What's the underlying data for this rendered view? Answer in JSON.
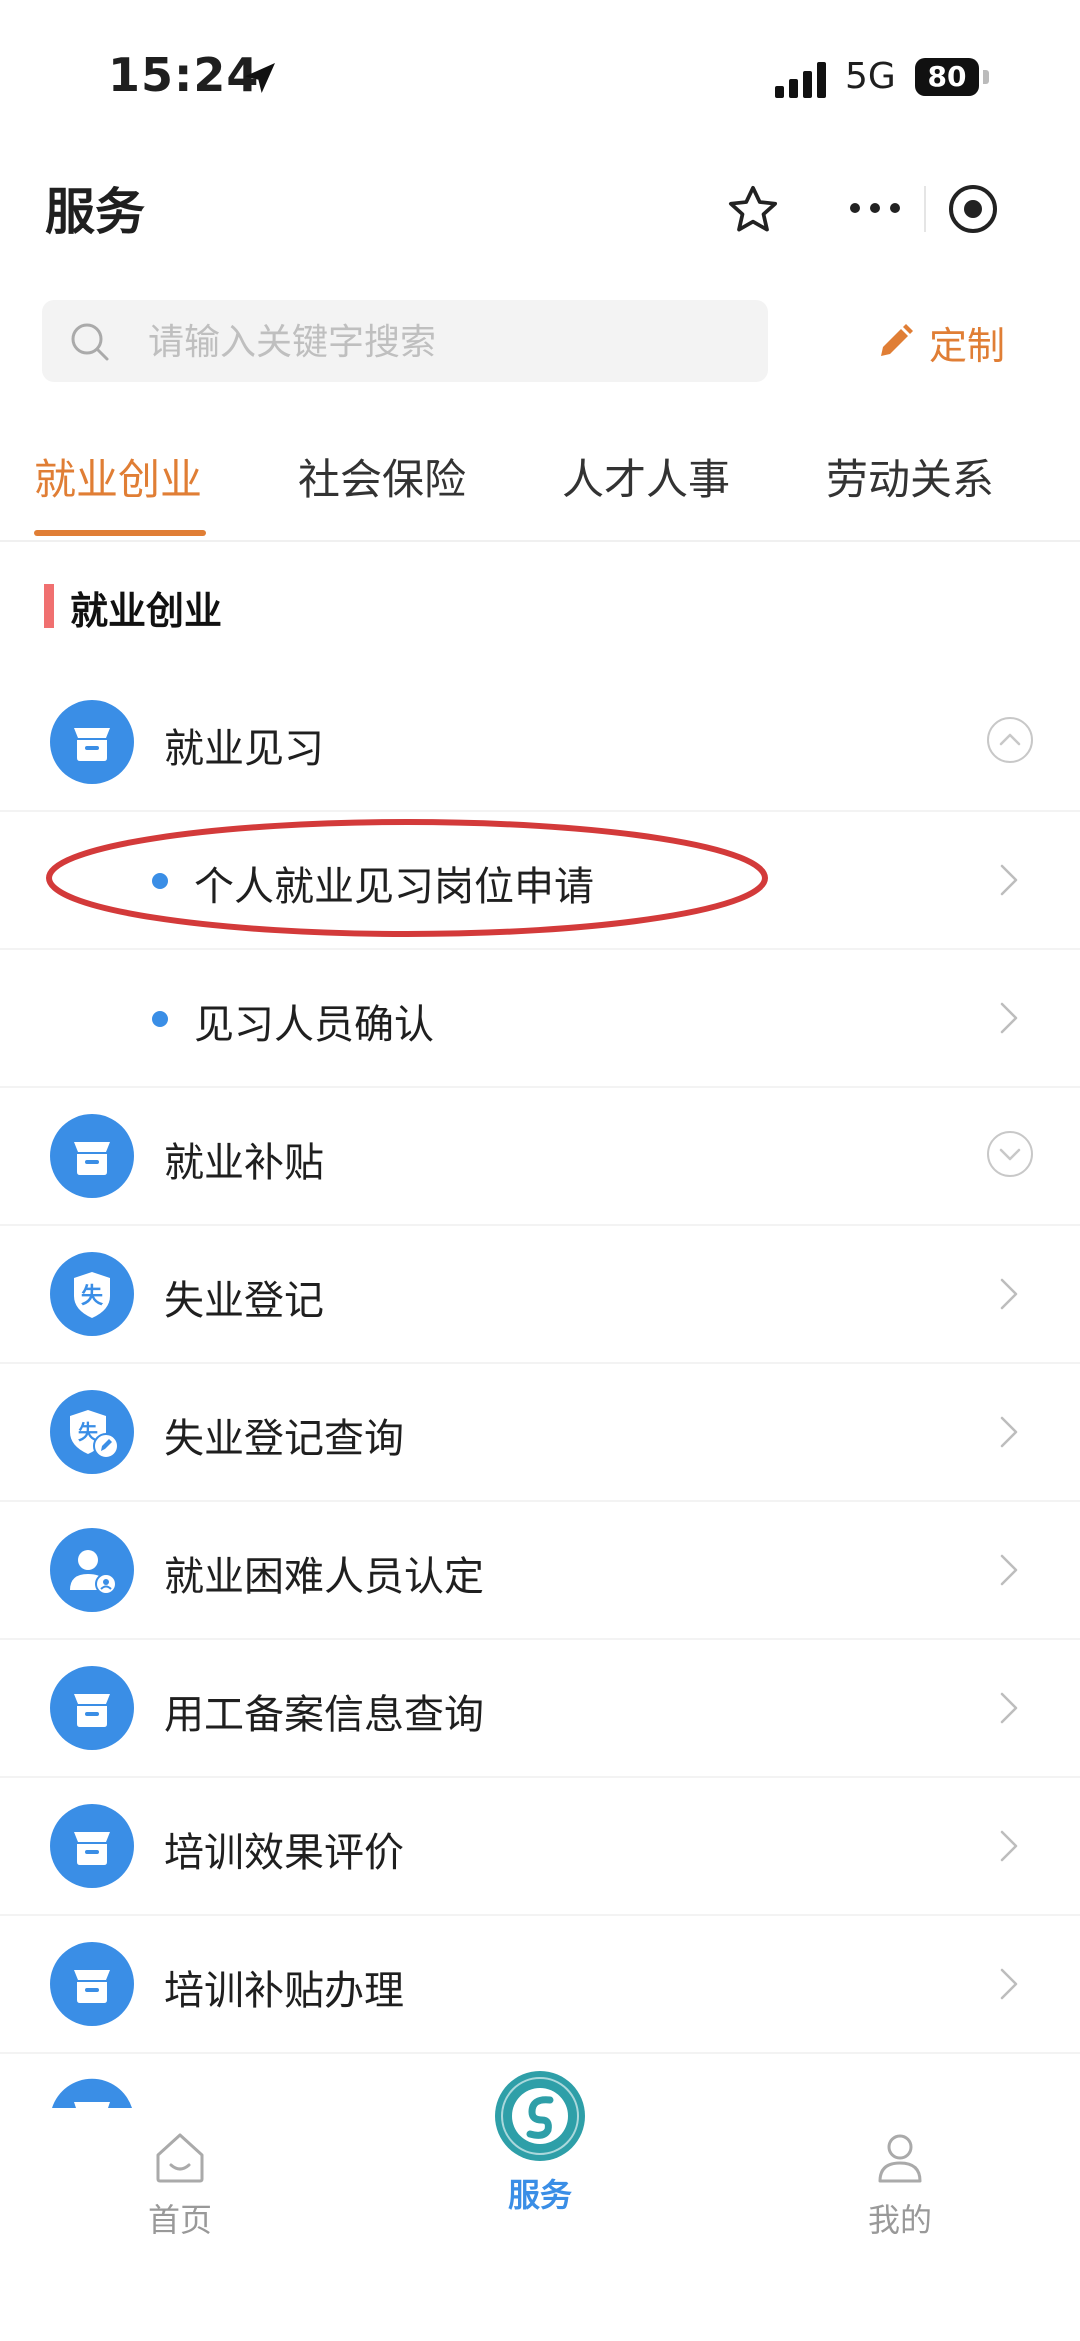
{
  "status_bar": {
    "time": "15:24",
    "network": "5G",
    "battery": "80"
  },
  "header": {
    "title": "服务"
  },
  "search": {
    "placeholder": "请输入关键字搜索",
    "customize_label": "定制"
  },
  "tabs": [
    {
      "label": "就业创业",
      "active": true
    },
    {
      "label": "社会保险",
      "active": false
    },
    {
      "label": "人才人事",
      "active": false
    },
    {
      "label": "劳动关系",
      "active": false
    }
  ],
  "section": {
    "title": "就业创业"
  },
  "items": [
    {
      "label": "就业见习",
      "icon": "box-icon",
      "expanded": true,
      "children": [
        {
          "label": "个人就业见习岗位申请",
          "highlighted": true
        },
        {
          "label": "见习人员确认"
        }
      ]
    },
    {
      "label": "就业补贴",
      "icon": "box-icon",
      "expanded": false
    },
    {
      "label": "失业登记",
      "icon": "shield-icon"
    },
    {
      "label": "失业登记查询",
      "icon": "badge-edit-icon"
    },
    {
      "label": "就业困难人员认定",
      "icon": "person-icon"
    },
    {
      "label": "用工备案信息查询",
      "icon": "box-icon"
    },
    {
      "label": "培训效果评价",
      "icon": "box-icon"
    },
    {
      "label": "培训补贴办理",
      "icon": "box-icon"
    }
  ],
  "icon_badges": {
    "unemployment": "失"
  },
  "bottom_nav": [
    {
      "label": "首页",
      "icon": "home-icon",
      "active": false
    },
    {
      "label": "服务",
      "icon": "service-logo-icon",
      "active": true
    },
    {
      "label": "我的",
      "icon": "user-icon",
      "active": false
    }
  ],
  "colors": {
    "accent": "#e07e35",
    "primary_blue": "#3a8ee6",
    "annotation_red": "#d33a3a",
    "section_bar": "#f07070"
  }
}
